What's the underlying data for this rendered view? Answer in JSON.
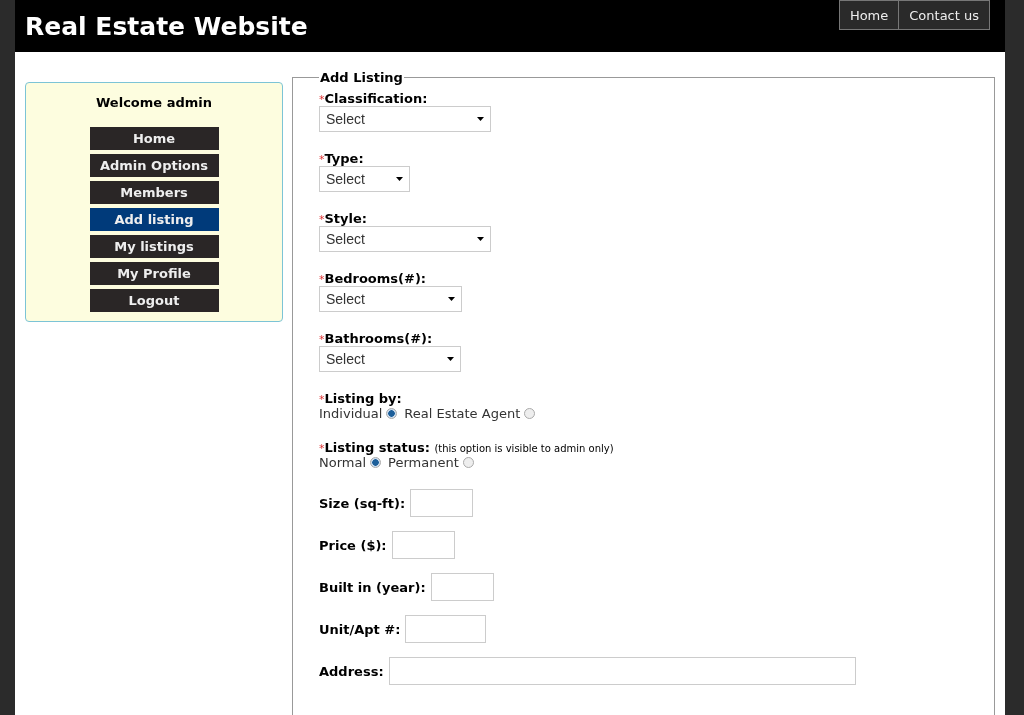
{
  "site_title": "Real Estate Website",
  "top_nav": [
    {
      "label": "Home"
    },
    {
      "label": "Contact us"
    }
  ],
  "sidebar": {
    "welcome": "Welcome admin",
    "items": [
      {
        "label": "Home",
        "selected": false
      },
      {
        "label": "Admin Options",
        "selected": false
      },
      {
        "label": "Members",
        "selected": false
      },
      {
        "label": "Add listing",
        "selected": true
      },
      {
        "label": "My listings",
        "selected": false
      },
      {
        "label": "My Profile",
        "selected": false
      },
      {
        "label": "Logout",
        "selected": false
      }
    ]
  },
  "form": {
    "legend": "Add Listing",
    "fields": [
      {
        "kind": "select",
        "required_mark": "*",
        "label": "Classification:",
        "value": "Select"
      },
      {
        "kind": "select",
        "required_mark": "*",
        "label": "Type:",
        "value": "Select"
      },
      {
        "kind": "select",
        "required_mark": "*",
        "label": "Style:",
        "value": "Select"
      },
      {
        "kind": "select",
        "required_mark": "*",
        "label": "Bedrooms(#):",
        "value": "Select"
      },
      {
        "kind": "select",
        "required_mark": "*",
        "label": "Bathrooms(#):",
        "value": "Select"
      },
      {
        "kind": "radio",
        "required_mark": "*",
        "label": "Listing by:",
        "options": [
          {
            "label": "Individual",
            "selected": true
          },
          {
            "label": "Real Estate Agent",
            "selected": false
          }
        ]
      },
      {
        "kind": "radio",
        "required_mark": "*",
        "label": "Listing status:",
        "note": "(this option is visible to admin only)",
        "options": [
          {
            "label": "Normal",
            "selected": true
          },
          {
            "label": "Permanent",
            "selected": false
          }
        ]
      },
      {
        "kind": "text",
        "label": "Size (sq-ft):"
      },
      {
        "kind": "text",
        "label": "Price ($):"
      },
      {
        "kind": "text",
        "label": "Built in (year):"
      },
      {
        "kind": "text",
        "label": "Unit/Apt #:"
      },
      {
        "kind": "text",
        "label": "Address:"
      }
    ]
  }
}
